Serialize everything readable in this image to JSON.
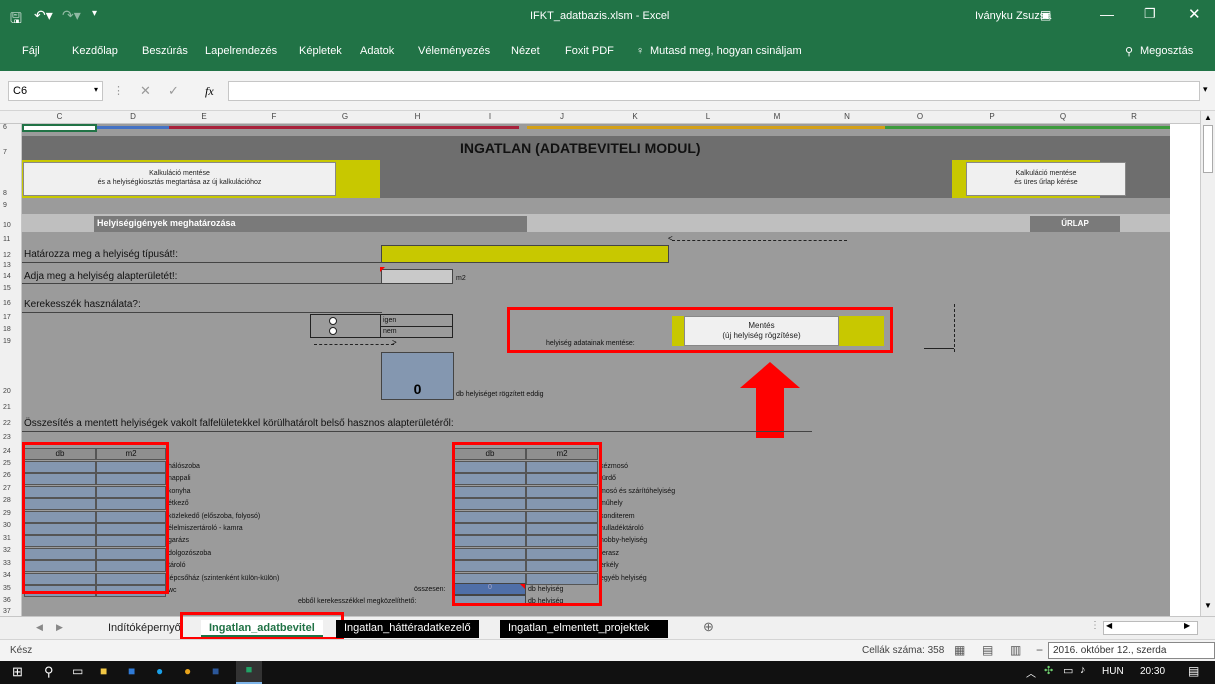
{
  "titlebar": {
    "filename": "IFKT_adatbazis.xlsm - Excel",
    "user": "Iványku Zsuzsa"
  },
  "ribbon": {
    "tabs": [
      "Fájl",
      "Kezdőlap",
      "Beszúrás",
      "Lapelrendezés",
      "Képletek",
      "Adatok",
      "Véleményezés",
      "Nézet",
      "Foxit PDF"
    ],
    "tell_me": "Mutasd meg, hogyan csináljam",
    "share": "Megosztás"
  },
  "formula": {
    "name_box": "C6",
    "fx": "fx",
    "value": ""
  },
  "columns": [
    "C",
    "D",
    "E",
    "F",
    "G",
    "H",
    "I",
    "J",
    "K",
    "L",
    "M",
    "N",
    "O",
    "P",
    "Q",
    "R"
  ],
  "rows": [
    "6",
    "7",
    "8",
    "9",
    "10",
    "11",
    "12",
    "13",
    "14",
    "15",
    "16",
    "17",
    "18",
    "19",
    "20",
    "21",
    "22",
    "23",
    "24",
    "25",
    "26",
    "27",
    "28",
    "29",
    "30",
    "31",
    "32",
    "33",
    "34",
    "35",
    "36",
    "37"
  ],
  "form": {
    "title": "INGATLAN (ADATBEVITELI MODUL)",
    "btn_save_calc": "Kalkuláció mentése\nés a helyiségkiosztás megtartása az új kalkulációhoz",
    "btn_save_empty": "Kalkuláció mentése\nés üres űrlap kérése",
    "section": "Helyiségigények meghatározása",
    "urlap": "ŰRLAP",
    "q_type": "Határozza meg a helyiség típusát!:",
    "q_area": "Adja meg a helyiség alapterületét!:",
    "unit_m2": "m2",
    "q_wheelchair": "Kerekesszék használata?:",
    "opt_yes": "igen",
    "opt_no": "nem",
    "save_label": "helyiség adatainak mentése:",
    "save_btn": "Mentés\n(új helyiség rögzítése)",
    "count_value": "0",
    "count_label": "db helyiséget rögzített eddig",
    "summary": "Összesítés a mentett helyiségek vakolt falfelületekkel körülhatárolt belső hasznos alapterületéről:",
    "col_db": "db",
    "col_m2": "m2",
    "rooms_left": [
      "hálószoba",
      "nappali",
      "konyha",
      "étkező",
      "közlekedő (előszoba, folyosó)",
      "élelmiszertároló - kamra",
      "garázs",
      "dolgozószoba",
      "tároló",
      "lépcsőház (szintenként külön-külön)",
      "wc"
    ],
    "rooms_right": [
      "kézmosó",
      "fürdő",
      "mosó és szárítóhelyiség",
      "műhely",
      "konditerem",
      "hulladéktároló",
      "hobby-helyiség",
      "terasz",
      "erkély",
      "egyéb helyiség"
    ],
    "total_label": "összesen:",
    "total_value": "0",
    "total_unit": "db helyiség",
    "wheel_label": "ebből kerekesszékkel megközelíthető:",
    "wheel_unit": "db helyiség"
  },
  "sheets": [
    "Indítóképernyő",
    "Ingatlan_adatbevitel",
    "Ingatlan_háttéradatkezelő",
    "Ingatlan_elmentett_projektek"
  ],
  "status": {
    "ready": "Kész",
    "cells": "Cellák száma: 358",
    "date_tooltip": "2016. október 12., szerda"
  },
  "taskbar": {
    "lang": "HUN",
    "time": "20:30"
  },
  "colors": {
    "excel_green": "#217346",
    "yellow": "#c8c800",
    "cell_blue": "#8497b0",
    "red": "#ff0000"
  }
}
